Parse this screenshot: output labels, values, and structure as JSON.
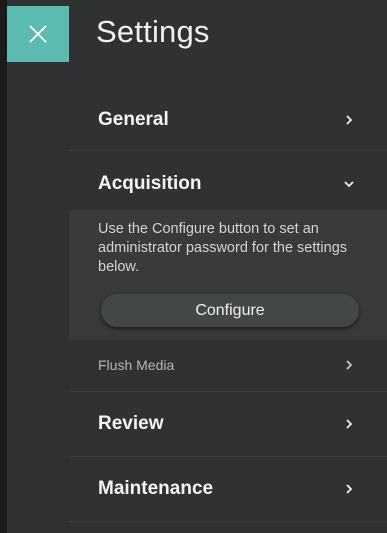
{
  "header": {
    "close_icon": "close-icon",
    "title": "Settings"
  },
  "sections": {
    "general": {
      "label": "General",
      "icon": "chevron-right-icon"
    },
    "acquisition": {
      "label": "Acquisition",
      "icon": "chevron-down-icon",
      "expanded": true,
      "description": "Use the Configure button to set an administrator password for the settings below.",
      "configure_label": "Configure",
      "items": [
        {
          "label": "Flush Media",
          "icon": "chevron-right-icon"
        }
      ]
    },
    "review": {
      "label": "Review",
      "icon": "chevron-right-icon"
    },
    "maintenance": {
      "label": "Maintenance",
      "icon": "chevron-right-icon"
    }
  },
  "colors": {
    "accent": "#5cbcb2",
    "panel": "#2f3132",
    "rail": "#2e3031",
    "expanded_bg": "#383a3b"
  }
}
